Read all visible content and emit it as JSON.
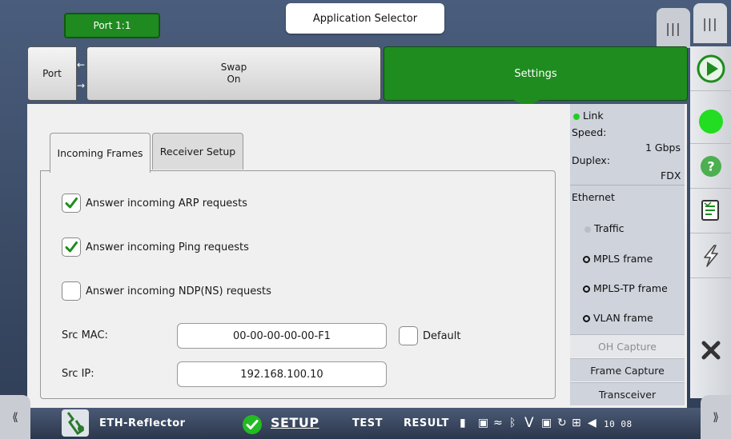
{
  "header": {
    "port": "Port 1:1",
    "app_selector": "Application Selector",
    "bars_glyph": "|||"
  },
  "toolbar": {
    "port_label": "Port",
    "swap_title": "Swap",
    "swap_state": "On",
    "settings_label": "Settings"
  },
  "tabs": [
    {
      "label": "Incoming Frames",
      "active": true
    },
    {
      "label": "Receiver Setup",
      "active": false
    }
  ],
  "options": [
    {
      "label": "Answer incoming ARP requests",
      "checked": true
    },
    {
      "label": "Answer incoming Ping requests",
      "checked": true
    },
    {
      "label": "Answer incoming NDP(NS) requests",
      "checked": false
    }
  ],
  "src_mac": {
    "label": "Src MAC:",
    "value": "00-00-00-00-00-F1",
    "default_label": "Default"
  },
  "src_ip": {
    "label": "Src IP:",
    "value": "192.168.100.10"
  },
  "status_panel": {
    "link": "Link",
    "speed_label": "Speed:",
    "speed_value": "1 Gbps",
    "duplex_label": "Duplex:",
    "duplex_value": "FDX",
    "ethernet": "Ethernet",
    "traffic": "Traffic",
    "mpls": "MPLS frame",
    "mpls_tp": "MPLS-TP frame",
    "vlan": "VLAN frame",
    "oh_capture": "OH Capture",
    "frame_capture": "Frame Capture",
    "transceiver": "Transceiver"
  },
  "bottom": {
    "app_name": "ETH-Reflector",
    "setup": "SETUP",
    "test": "TEST",
    "result": "RESULT",
    "time": "10 08",
    "left_chevron": "⟪",
    "right_chevron": "⟫"
  },
  "colors": {
    "accent_green": "#1e8c1e",
    "status_green": "#22cc22",
    "panel_bg": "#f0f0f0",
    "nav_blue": "#3d4e6b"
  }
}
